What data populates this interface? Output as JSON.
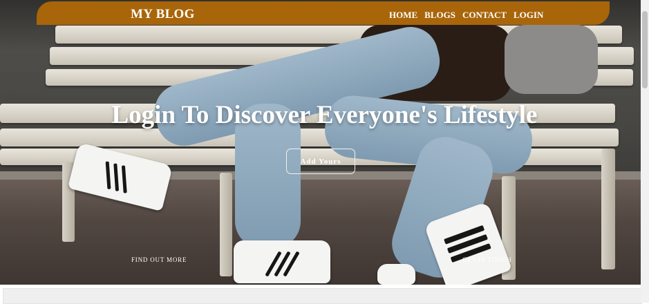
{
  "navbar": {
    "brand": "MY BLOG",
    "links": [
      "HOME",
      "BLOGS",
      "CONTACT",
      "LOGIN"
    ]
  },
  "hero": {
    "title": "Login To Discover Everyone's Lifestyle",
    "cta_label": "Add Yours",
    "left_link": "FIND OUT MORE",
    "right_link": "GET IN TOUCH"
  },
  "colors": {
    "accent": "#a8650a",
    "text_on_dark": "#ffffff"
  }
}
